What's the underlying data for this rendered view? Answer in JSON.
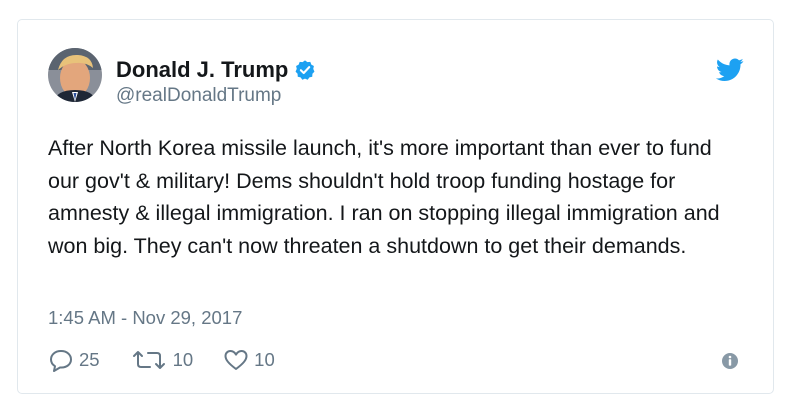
{
  "tweet": {
    "author": {
      "name": "Donald J. Trump",
      "handle": "@realDonaldTrump",
      "verified": true,
      "avatar_icon": "profile-photo"
    },
    "text": "After North Korea missile launch, it's more important than ever to fund our gov't & military! Dems shouldn't hold troop funding hostage for amnesty & illegal immigration. I ran on stopping illegal immigration and won big. They can't now threaten a shutdown to get their demands.",
    "timestamp": "1:45 AM - Nov 29, 2017",
    "actions": {
      "replies": "25",
      "retweets": "10",
      "likes": "10"
    }
  },
  "icons": {
    "brand": "twitter-bird-icon",
    "verified": "verified-badge-icon",
    "reply": "reply-icon",
    "retweet": "retweet-icon",
    "like": "heart-icon",
    "info": "info-icon"
  },
  "colors": {
    "brand": "#1da1f2",
    "text": "#14171a",
    "secondary": "#657786",
    "border": "#e1e8ed"
  }
}
